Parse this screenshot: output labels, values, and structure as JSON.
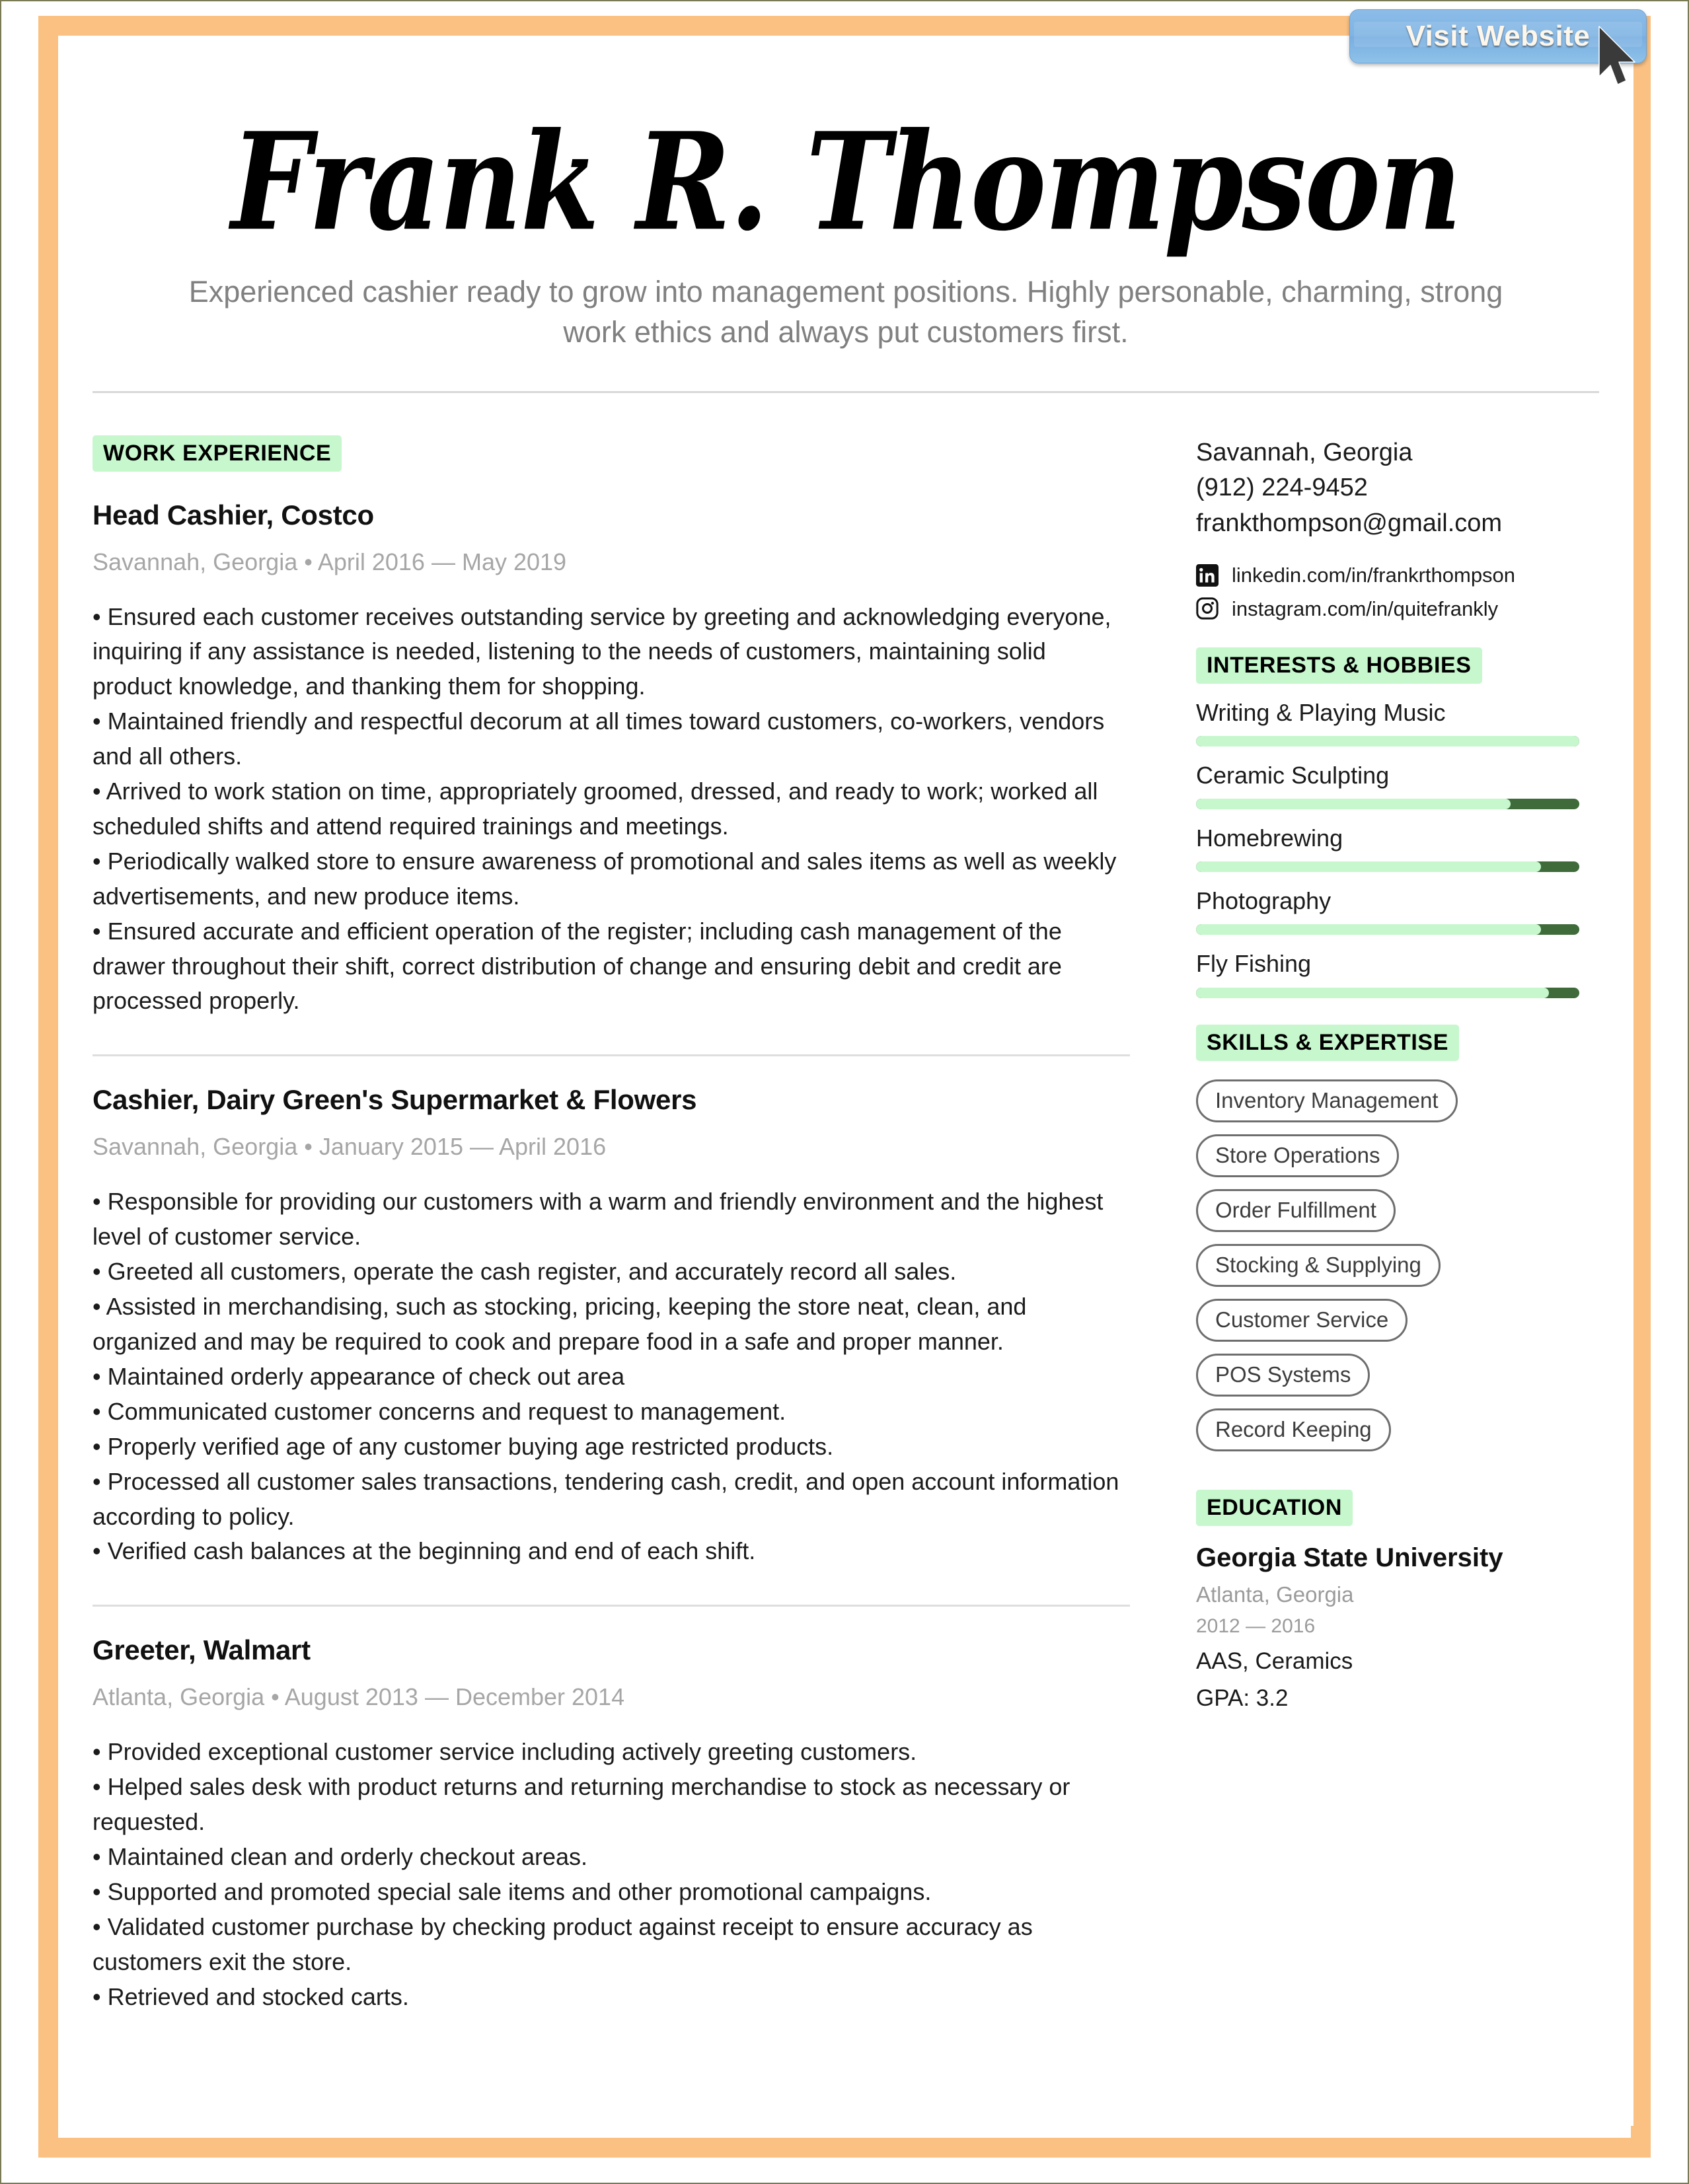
{
  "overlay": {
    "visit_button_label": "Visit Website",
    "cursor_icon": "mouse-pointer-icon"
  },
  "theme": {
    "frame_color": "#FAC183",
    "accent_highlight": "#C6F7CD",
    "bar_dark": "#3F6B3A",
    "muted_text": "#A6A6A6",
    "button_blue": "#7FB4E4"
  },
  "header": {
    "name": "Frank R. Thompson",
    "tagline": "Experienced cashier ready to grow into management positions. Highly personable, charming, strong work ethics and always put customers first."
  },
  "work_experience": {
    "section_label": "WORK EXPERIENCE",
    "jobs": [
      {
        "title": "Head Cashier, Costco",
        "meta": "Savannah, Georgia • April 2016 — May 2019",
        "bullets": [
          "• Ensured each customer receives outstanding service by greeting and acknowledging everyone, inquiring if any assistance is needed, listening to the needs of customers, maintaining solid product knowledge, and thanking them for shopping.",
          "• Maintained friendly and respectful decorum at all times toward customers, co-workers, vendors and all others.",
          "• Arrived to work station on time, appropriately groomed, dressed, and ready to work; worked all scheduled shifts and attend required trainings and meetings.",
          "• Periodically walked store to ensure awareness of promotional and sales items as well as weekly advertisements, and new produce items.",
          "• Ensured accurate and efficient operation of the register; including cash management of the drawer throughout their shift, correct distribution of change and ensuring debit and credit are processed properly."
        ]
      },
      {
        "title": "Cashier, Dairy Green's Supermarket & Flowers",
        "meta": "Savannah, Georgia • January 2015 — April 2016",
        "bullets": [
          "• Responsible for providing our customers with a warm and friendly environment and the highest level of customer service.",
          "• Greeted all customers, operate the cash register, and accurately record all sales.",
          "• Assisted in merchandising, such as stocking, pricing, keeping the store neat, clean, and organized and may be required to cook and prepare food in a safe and proper manner.",
          "• Maintained orderly appearance of check out area",
          "• Communicated customer concerns and request to management.",
          "• Properly verified age of any customer buying age restricted products.",
          "• Processed all customer sales transactions, tendering cash, credit, and open account information according to policy.",
          "• Verified cash balances at the beginning and end of each shift."
        ]
      },
      {
        "title": "Greeter, Walmart",
        "meta": "Atlanta, Georgia • August 2013 — December 2014",
        "bullets": [
          "• Provided exceptional customer service including actively greeting customers.",
          "• Helped sales desk with product returns and returning merchandise to stock as necessary or requested.",
          "• Maintained clean and orderly checkout areas.",
          "• Supported and promoted special sale items and other promotional campaigns.",
          "• Validated customer purchase by checking product against receipt to ensure accuracy as customers exit the store.",
          "• Retrieved and stocked carts."
        ]
      }
    ]
  },
  "contact": {
    "location": "Savannah, Georgia",
    "phone": "(912) 224-9452",
    "email": "frankthompson@gmail.com",
    "socials": [
      {
        "icon": "linkedin-icon",
        "handle": "linkedin.com/in/frankrthompson"
      },
      {
        "icon": "instagram-icon",
        "handle": "instagram.com/in/quitefrankly"
      }
    ]
  },
  "interests": {
    "section_label": "INTERESTS & HOBBIES",
    "items": [
      {
        "label": "Writing & Playing Music",
        "level": 100
      },
      {
        "label": "Ceramic Sculpting",
        "level": 82
      },
      {
        "label": "Homebrewing",
        "level": 90
      },
      {
        "label": "Photography",
        "level": 90
      },
      {
        "label": "Fly Fishing",
        "level": 92
      }
    ]
  },
  "skills": {
    "section_label": "SKILLS & EXPERTISE",
    "items": [
      "Inventory Management",
      "Store Operations",
      "Order Fulfillment",
      "Stocking & Supplying",
      "Customer Service",
      "POS Systems",
      "Record Keeping"
    ]
  },
  "education": {
    "section_label": "EDUCATION",
    "school": "Georgia State University",
    "location": "Atlanta, Georgia",
    "years": "2012 — 2016",
    "degree": "AAS, Ceramics",
    "gpa": "GPA: 3.2"
  }
}
